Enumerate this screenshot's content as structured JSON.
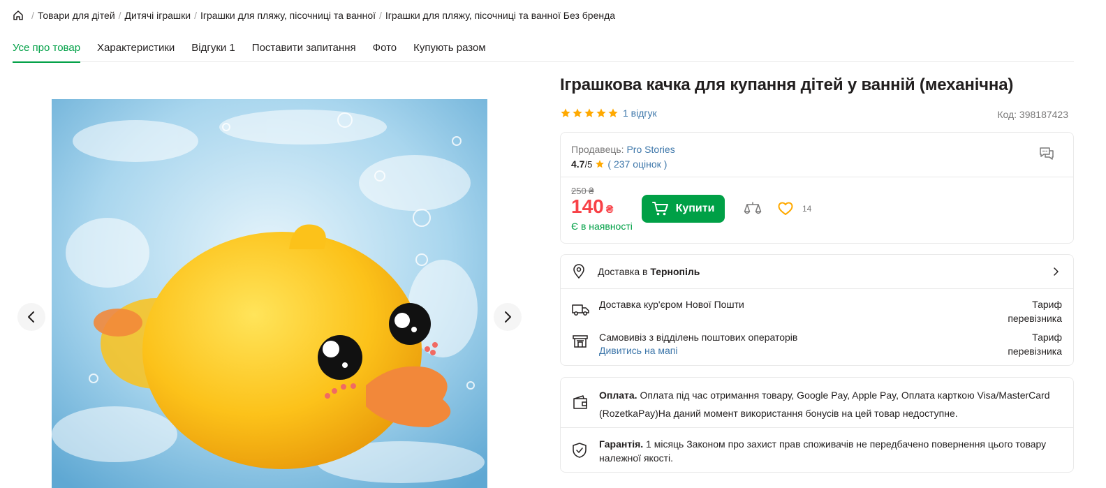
{
  "breadcrumbs": {
    "items": [
      "Товари для дітей",
      "Дитячі іграшки",
      "Іграшки для пляжу, пісочниці та ванної",
      "Іграшки для пляжу, пісочниці та ванної Без бренда"
    ],
    "separator": "/"
  },
  "tabs": [
    {
      "label": "Усе про товар",
      "active": true
    },
    {
      "label": "Характеристики",
      "active": false
    },
    {
      "label": "Відгуки 1",
      "active": false
    },
    {
      "label": "Поставити запитання",
      "active": false
    },
    {
      "label": "Фото",
      "active": false
    },
    {
      "label": "Купують разом",
      "active": false
    }
  ],
  "product": {
    "title": "Іграшкова качка для купання дітей у ванній (механічна)",
    "rating_stars": 5,
    "reviews_link": "1 відгук",
    "code_label": "Код:",
    "code_value": "398187423"
  },
  "seller": {
    "label": "Продавець:",
    "name": "Pro Stories",
    "rating": "4.7",
    "rating_max": "/5",
    "reviews_open": "(",
    "reviews_count": "237 оцінок",
    "reviews_close": ")"
  },
  "pricing": {
    "old_price": "250 ₴",
    "price": "140",
    "currency": "₴",
    "availability": "Є в наявності",
    "buy_label": "Купити",
    "wishlist_count": "14"
  },
  "delivery": {
    "city_prefix": "Доставка в",
    "city": "Тернопіль",
    "options": [
      {
        "name": "Доставка кур'єром Нової Пошти",
        "link": "",
        "tarif_1": "Тариф",
        "tarif_2": "перевізника",
        "icon": "truck-icon"
      },
      {
        "name": "Самовивіз з відділень поштових операторів",
        "link": "Дивитись на мапі",
        "tarif_1": "Тариф",
        "tarif_2": "перевізника",
        "icon": "post-office-icon"
      }
    ]
  },
  "payment": {
    "label": "Оплата.",
    "text": "Оплата під час отримання товару, Google Pay, Apple Pay, Оплата карткою Visa/MasterCard (RozetkaPay)На даний момент використання бонусів на цей товар недоступне."
  },
  "warranty": {
    "label": "Гарантія.",
    "text": "1 місяць Законом про захист прав споживачів не передбачено повернення цього товару належної якості."
  },
  "colors": {
    "accent_green": "#00a046",
    "price_red": "#f84147",
    "link_blue": "#3e77aa",
    "star_yellow": "#ffa900"
  }
}
